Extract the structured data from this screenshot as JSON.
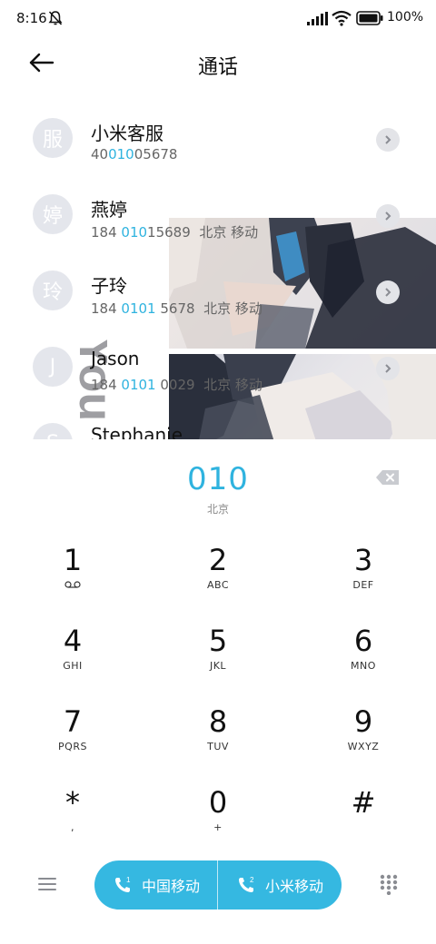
{
  "status_bar": {
    "time": "8:16",
    "battery": "100%",
    "icons": [
      "bell-off-icon",
      "signal-icon",
      "wifi-icon",
      "battery-icon"
    ]
  },
  "header": {
    "title": "通话",
    "back_icon": "arrow-left-icon"
  },
  "contacts": [
    {
      "avatar": "服",
      "name": "小米客服",
      "num_pre": "40",
      "num_hl": "010",
      "num_post": "05678",
      "location": ""
    },
    {
      "avatar": "婷",
      "name": "燕婷",
      "num_pre": "184 ",
      "num_hl": "010",
      "num_post": "15689",
      "location": "北京 移动"
    },
    {
      "avatar": "玲",
      "name": "子玲",
      "num_pre": "184 ",
      "num_hl": "0101",
      "num_post": " 5678",
      "location": "北京 移动"
    },
    {
      "avatar": "J",
      "name": "Jason",
      "num_pre": "184 ",
      "num_hl": "0101",
      "num_post": " 0029",
      "location": "北京 移动"
    },
    {
      "avatar": "S",
      "name": "Stephanie",
      "num_pre": "",
      "num_hl": "",
      "num_post": "",
      "location": ""
    }
  ],
  "wallpaper_text": "You",
  "dialer": {
    "number": "010",
    "location": "北京",
    "keys": [
      {
        "digit": "1",
        "letters": ""
      },
      {
        "digit": "2",
        "letters": "ABC"
      },
      {
        "digit": "3",
        "letters": "DEF"
      },
      {
        "digit": "4",
        "letters": "GHI"
      },
      {
        "digit": "5",
        "letters": "JKL"
      },
      {
        "digit": "6",
        "letters": "MNO"
      },
      {
        "digit": "7",
        "letters": "PQRS"
      },
      {
        "digit": "8",
        "letters": "TUV"
      },
      {
        "digit": "9",
        "letters": "WXYZ"
      },
      {
        "digit": "*",
        "letters": ","
      },
      {
        "digit": "0",
        "letters": "+"
      },
      {
        "digit": "#",
        "letters": ""
      }
    ]
  },
  "bottom_bar": {
    "sim1_label": "中国移动",
    "sim2_label": "小米移动",
    "accent_color": "#35b8e1"
  }
}
